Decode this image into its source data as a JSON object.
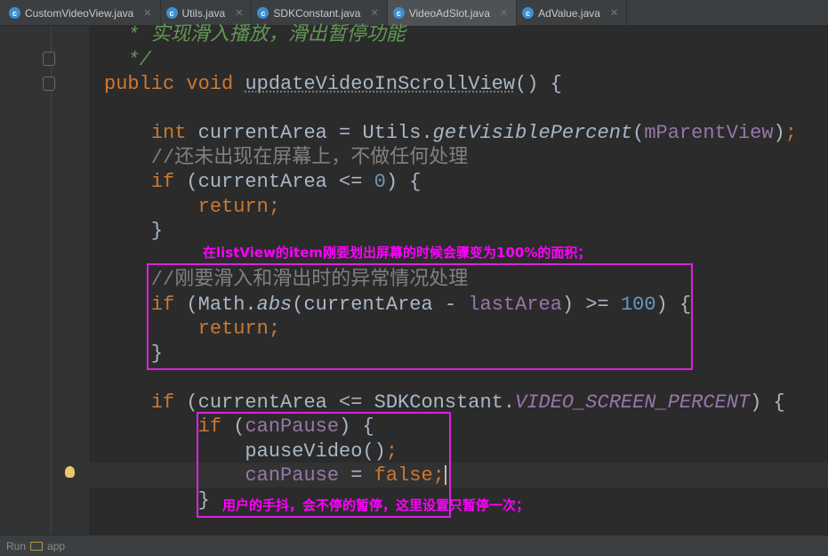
{
  "tabs": [
    {
      "label": "CustomVideoView.java",
      "active": false
    },
    {
      "label": "Utils.java",
      "active": false
    },
    {
      "label": "SDKConstant.java",
      "active": false
    },
    {
      "label": "VideoAdSlot.java",
      "active": true
    },
    {
      "label": "AdValue.java",
      "active": false
    }
  ],
  "code_lines": [
    [
      {
        "t": "  * 实现滑入播放，滑出暂停功能",
        "c": "doc"
      }
    ],
    [
      {
        "t": "  */",
        "c": "doc"
      }
    ],
    [
      {
        "t": "public void ",
        "c": "kw"
      },
      {
        "t": "updateVideoInScrollView",
        "c": "ul"
      },
      {
        "t": "() {",
        "c": ""
      }
    ],
    [],
    [
      {
        "t": "    ",
        "c": ""
      },
      {
        "t": "int ",
        "c": "kw"
      },
      {
        "t": "currentArea = Utils.",
        "c": ""
      },
      {
        "t": "getVisiblePercent",
        "c": "it"
      },
      {
        "t": "(",
        "c": ""
      },
      {
        "t": "mParentView",
        "c": "fd"
      },
      {
        "t": ")",
        "c": ""
      },
      {
        "t": ";",
        "c": "kw"
      }
    ],
    [
      {
        "t": "    //还未出现在屏幕上，不做任何处理",
        "c": "cm"
      }
    ],
    [
      {
        "t": "    ",
        "c": ""
      },
      {
        "t": "if ",
        "c": "kw"
      },
      {
        "t": "(currentArea <= ",
        "c": ""
      },
      {
        "t": "0",
        "c": "num"
      },
      {
        "t": ") {",
        "c": ""
      }
    ],
    [
      {
        "t": "        ",
        "c": ""
      },
      {
        "t": "return;",
        "c": "kw"
      }
    ],
    [
      {
        "t": "    }",
        "c": ""
      }
    ],
    [],
    [
      {
        "t": "    //刚要滑入和滑出时的异常情况处理",
        "c": "cm"
      }
    ],
    [
      {
        "t": "    ",
        "c": ""
      },
      {
        "t": "if ",
        "c": "kw"
      },
      {
        "t": "(Math.",
        "c": ""
      },
      {
        "t": "abs",
        "c": "it"
      },
      {
        "t": "(currentArea - ",
        "c": ""
      },
      {
        "t": "lastArea",
        "c": "fd"
      },
      {
        "t": ") >= ",
        "c": ""
      },
      {
        "t": "100",
        "c": "num"
      },
      {
        "t": ") {",
        "c": ""
      }
    ],
    [
      {
        "t": "        ",
        "c": ""
      },
      {
        "t": "return;",
        "c": "kw"
      }
    ],
    [
      {
        "t": "    }",
        "c": ""
      }
    ],
    [],
    [
      {
        "t": "    ",
        "c": ""
      },
      {
        "t": "if ",
        "c": "kw"
      },
      {
        "t": "(currentArea <= SDKConstant.",
        "c": ""
      },
      {
        "t": "VIDEO_SCREEN_PERCENT",
        "c": "fdi"
      },
      {
        "t": ") {",
        "c": ""
      }
    ],
    [
      {
        "t": "        ",
        "c": ""
      },
      {
        "t": "if ",
        "c": "kw"
      },
      {
        "t": "(",
        "c": ""
      },
      {
        "t": "canPause",
        "c": "fd"
      },
      {
        "t": ") {",
        "c": ""
      }
    ],
    [
      {
        "t": "            pauseVideo()",
        "c": ""
      },
      {
        "t": ";",
        "c": "kw"
      }
    ],
    [
      {
        "t": "            ",
        "c": ""
      },
      {
        "t": "canPause",
        "c": "fd"
      },
      {
        "t": " = ",
        "c": ""
      },
      {
        "t": "false;",
        "c": "kw"
      }
    ],
    [
      {
        "t": "        }",
        "c": ""
      }
    ]
  ],
  "annotations": {
    "note1": "在listView的item刚要划出屏幕的时候会骤变为100%的面积；",
    "note2": "用户的手抖，会不停的暂停，这里设置只暂停一次；"
  },
  "status": {
    "run": "Run",
    "app": "app"
  }
}
